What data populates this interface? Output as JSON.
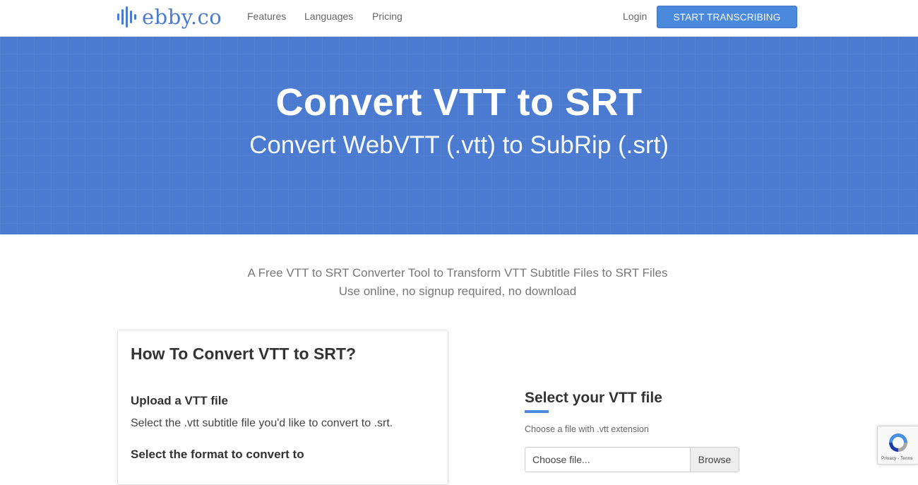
{
  "nav": {
    "logo_text": "ebby.co",
    "links": [
      {
        "label": "Features"
      },
      {
        "label": "Languages"
      },
      {
        "label": "Pricing"
      }
    ],
    "login_label": "Login",
    "cta_label": "START TRANSCRIBING"
  },
  "hero": {
    "title": "Convert VTT to SRT",
    "subtitle": "Convert WebVTT (.vtt) to SubRip (.srt)"
  },
  "intro": {
    "line1": "A Free VTT to SRT Converter Tool to Transform VTT Subtitle Files to SRT Files",
    "line2": "Use online, no signup required, no download"
  },
  "how_to": {
    "title": "How To Convert VTT to SRT?",
    "steps": [
      {
        "title": "Upload a VTT file",
        "desc": "Select the .vtt subtitle file you'd like to convert to .srt."
      },
      {
        "title": "Select the format to convert to"
      }
    ]
  },
  "upload": {
    "title": "Select your VTT file",
    "hint": "Choose a file with .vtt extension",
    "placeholder": "Choose file...",
    "browse_label": "Browse"
  },
  "recaptcha": {
    "text": "Privacy - Terms"
  },
  "colors": {
    "brand": "#4a7bd0",
    "button": "#4a89dc"
  }
}
